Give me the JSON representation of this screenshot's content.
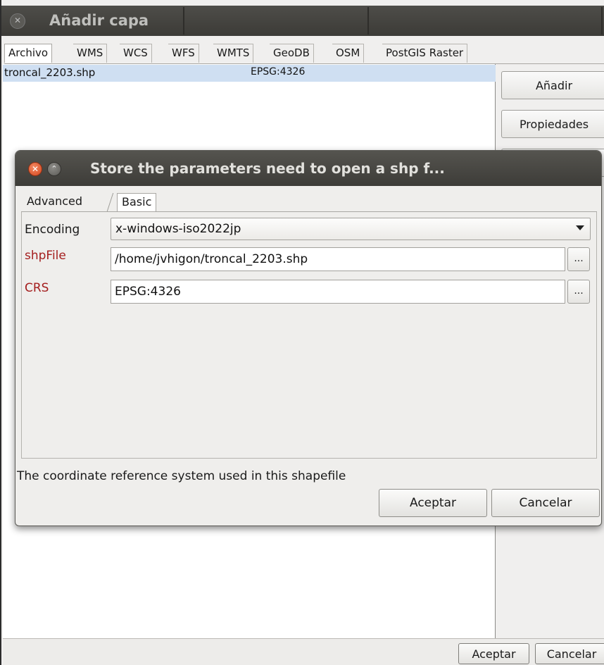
{
  "main_window": {
    "title": "Añadir capa",
    "tabs": [
      "Archivo",
      "WMS",
      "WCS",
      "WFS",
      "WMTS",
      "GeoDB",
      "OSM",
      "PostGIS Raster"
    ],
    "active_tab": "Archivo",
    "files": [
      {
        "name": "troncal_2203.shp",
        "crs": "EPSG:4326"
      }
    ],
    "side_buttons": {
      "add": "Añadir",
      "properties": "Propiedades"
    },
    "bottom_buttons": {
      "accept": "Aceptar",
      "cancel": "Cancelar"
    }
  },
  "dialog": {
    "title": "Store the parameters need to open a shp f...",
    "tabs": [
      "Advanced",
      "Basic"
    ],
    "active_tab": "Basic",
    "fields": {
      "encoding": {
        "label": "Encoding",
        "value": "x-windows-iso2022jp"
      },
      "shpfile": {
        "label": "shpFile",
        "value": "/home/jvhigon/troncal_2203.shp",
        "browse": "..."
      },
      "crs": {
        "label": "CRS",
        "value": "EPSG:4326",
        "browse": "..."
      }
    },
    "help_text": "The coordinate reference system used in this shapefile",
    "buttons": {
      "accept": "Aceptar",
      "cancel": "Cancelar"
    }
  },
  "colors": {
    "required_label": "#a41e1e",
    "selected_row": "#cfdff2",
    "titlebar": "#3c3b37",
    "close_button": "#d4461e"
  },
  "icons": {
    "main_close": "close-icon",
    "dialog_close": "close-icon",
    "dialog_maximize": "maximize-icon",
    "select_arrow": "chevron-down-icon"
  }
}
